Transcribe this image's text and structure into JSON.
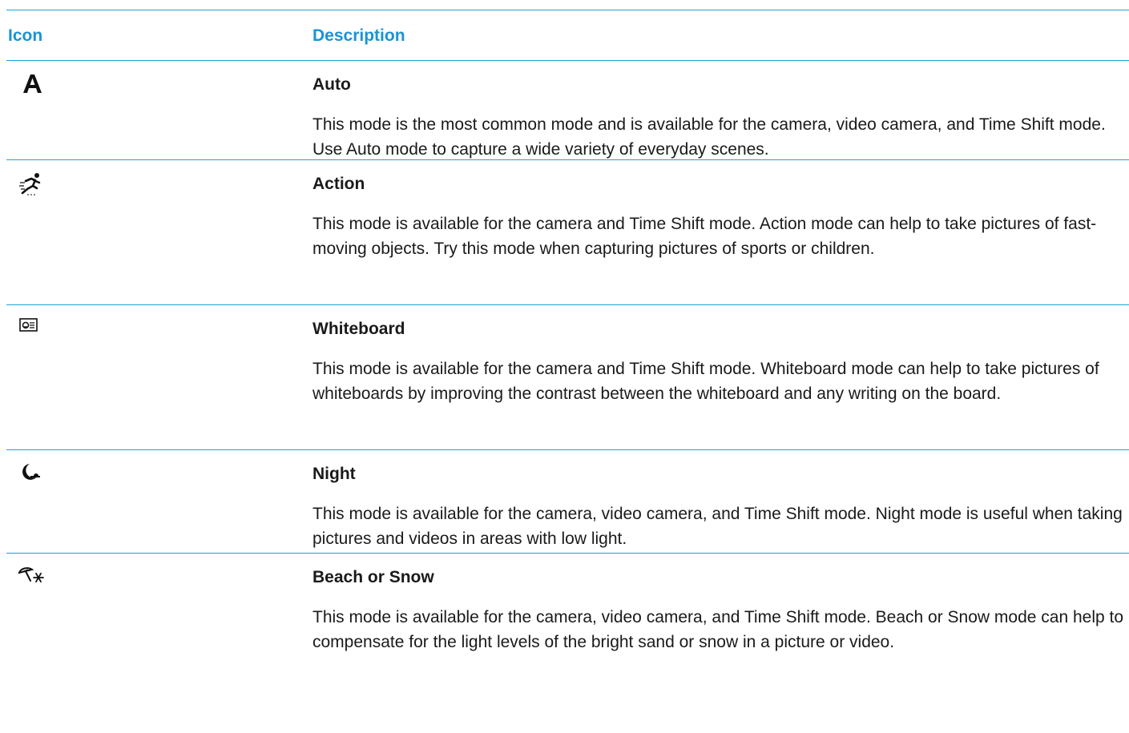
{
  "table": {
    "headers": {
      "icon": "Icon",
      "description": "Description"
    },
    "rows": [
      {
        "icon": "auto-mode-icon",
        "title": "Auto",
        "body": "This mode is the most common mode and is available for the camera, video camera, and Time Shift mode. Use Auto mode to capture a wide variety of everyday scenes."
      },
      {
        "icon": "action-mode-icon",
        "title": "Action",
        "body": "This mode is available for the camera and Time Shift mode. Action mode can help to take pictures of fast-moving objects. Try this mode when capturing pictures of sports or children."
      },
      {
        "icon": "whiteboard-mode-icon",
        "title": "Whiteboard",
        "body": "This mode is available for the camera and Time Shift mode. Whiteboard mode can help to take pictures of whiteboards by improving the contrast between the whiteboard and any writing on the board."
      },
      {
        "icon": "night-mode-icon",
        "title": "Night",
        "body": "This mode is available for the camera, video camera, and Time Shift mode. Night mode is useful when taking pictures and videos in areas with low light."
      },
      {
        "icon": "beach-snow-mode-icon",
        "title": "Beach or Snow",
        "body": "This mode is available for the camera, video camera, and Time Shift mode. Beach or Snow mode can help to compensate for the light levels of the bright sand or snow in a picture or video."
      }
    ]
  },
  "colors": {
    "header_text": "#1a93d6",
    "rule": "#1aa3d6",
    "body_text": "#1a1a1a"
  }
}
